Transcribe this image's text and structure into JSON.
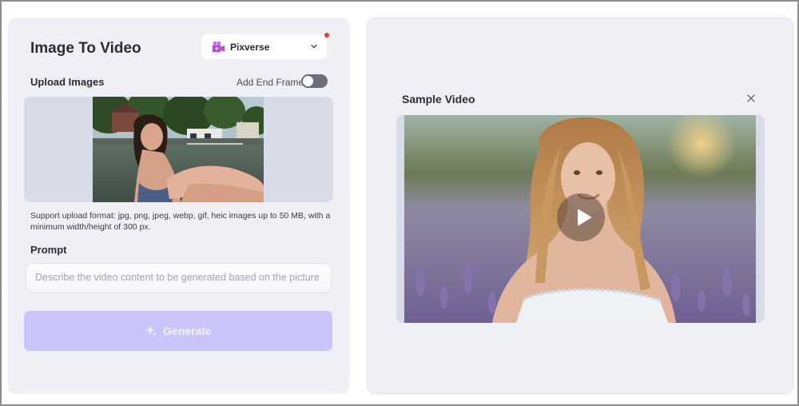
{
  "left": {
    "title": "Image To Video",
    "model_select": {
      "value": "Pixverse",
      "icon": "pixverse-camera-icon",
      "notification": true
    },
    "upload": {
      "label": "Upload Images",
      "end_frame_label": "Add End Frame",
      "end_frame_enabled": false,
      "support_text": "Support upload format: jpg, png, jpeg, webp, gif, heic images up to 50 MB, with a minimum width/height of 300 px."
    },
    "prompt": {
      "label": "Prompt",
      "placeholder": "Describe the video content to be generated based on the picture",
      "value": ""
    },
    "generate_label": "Generate"
  },
  "right": {
    "title": "Sample Video"
  },
  "colors": {
    "panel_bg": "#eef0f5",
    "upload_bg": "#d7dce8",
    "generate_bg": "#c9c5fb",
    "brand_icon": "#b44fd8",
    "notification": "#e23b3b"
  }
}
